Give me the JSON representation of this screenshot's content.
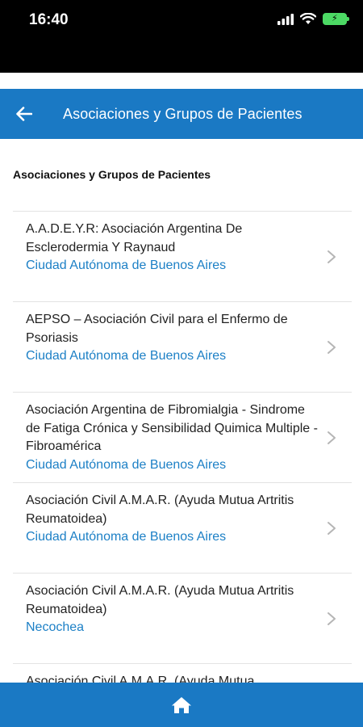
{
  "status_bar": {
    "time": "16:40"
  },
  "header": {
    "title": "Asociaciones y Grupos de Pacientes"
  },
  "section": {
    "title": "Asociaciones y Grupos de Pacientes"
  },
  "list": {
    "items": [
      {
        "name": "A.A.D.E.Y.R: Asociación Argentina De Esclerodermia Y Raynaud",
        "location": "Ciudad Autónoma de Buenos Aires"
      },
      {
        "name": "AEPSO – Asociación Civil para el Enfermo de Psoriasis",
        "location": "Ciudad Autónoma de Buenos Aires"
      },
      {
        "name": "Asociación Argentina de Fibromialgia - Sindrome de Fatiga Crónica y Sensibilidad Quimica Multiple - Fibroamérica",
        "location": "Ciudad Autónoma de Buenos Aires"
      },
      {
        "name": "Asociación Civil A.M.A.R. (Ayuda Mutua Artritis Reumatoidea)",
        "location": "Ciudad Autónoma de Buenos Aires"
      },
      {
        "name": "Asociación Civil A.M.A.R. (Ayuda Mutua Artritis Reumatoidea)",
        "location": "Necochea"
      },
      {
        "name": "Asociación Civil A.M.A.R. (Ayuda Mutua",
        "location": ""
      }
    ]
  },
  "icons": {
    "back": "arrow-left-icon",
    "chevron": "chevron-right-icon",
    "home": "home-icon"
  },
  "colors": {
    "primary": "#1a79c4",
    "location_text": "#1d80c6"
  }
}
